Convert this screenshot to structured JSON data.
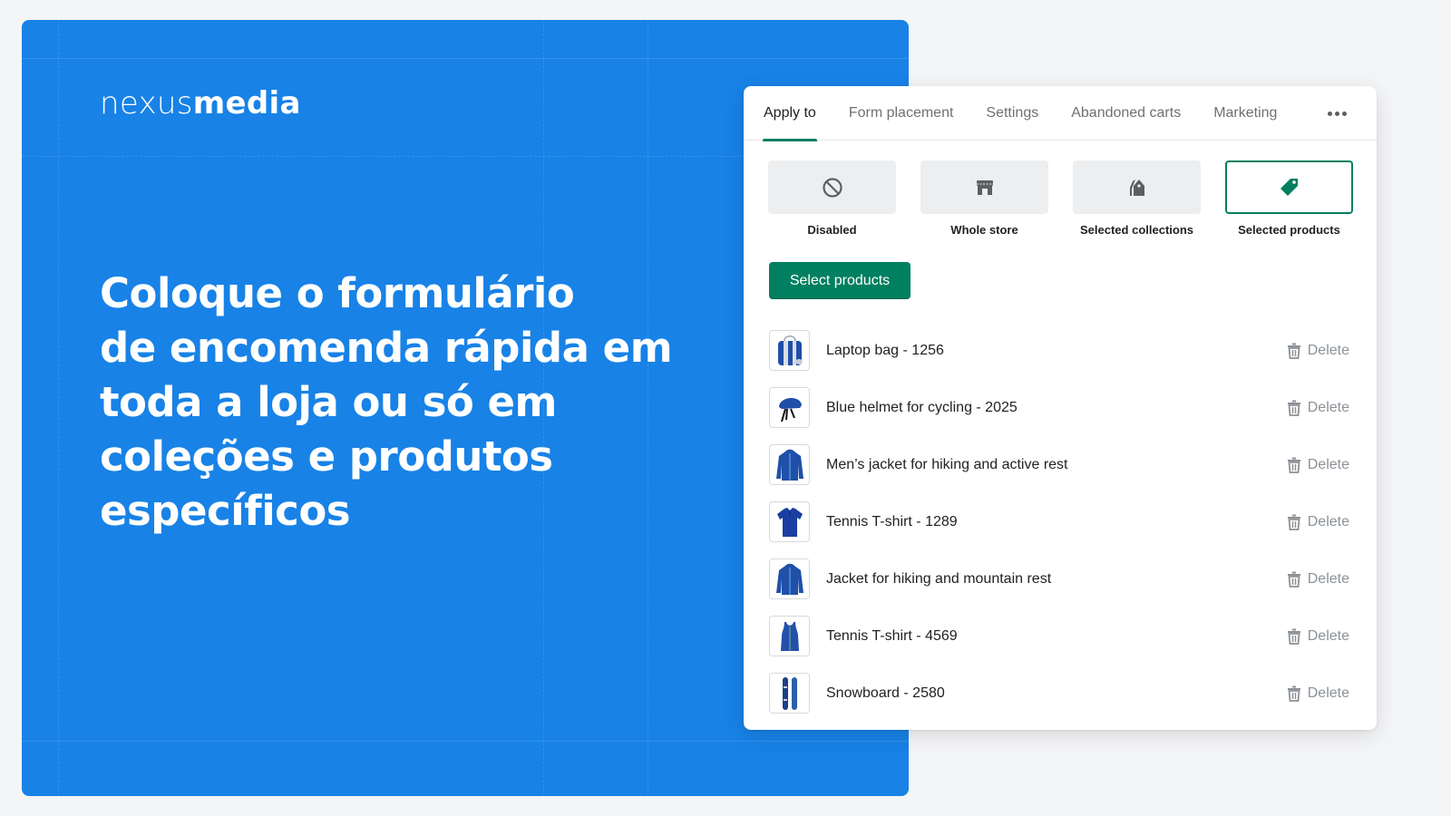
{
  "brand": {
    "logo_light": "nexus",
    "logo_bold": "media"
  },
  "headline": {
    "lines": [
      "Coloque o formulário",
      "de encomenda rápida em",
      "toda a loja ou só em",
      "coleções e produtos",
      "específicos"
    ]
  },
  "tabs": [
    {
      "label": "Apply to",
      "active": true
    },
    {
      "label": "Form placement",
      "active": false
    },
    {
      "label": "Settings",
      "active": false
    },
    {
      "label": "Abandoned carts",
      "active": false
    },
    {
      "label": "Marketing",
      "active": false
    }
  ],
  "more_icon": "horizontal-dots-icon",
  "apply_options": [
    {
      "label": "Disabled",
      "icon": "disabled-circle-icon",
      "selected": false
    },
    {
      "label": "Whole store",
      "icon": "store-icon",
      "selected": false
    },
    {
      "label": "Selected collections",
      "icon": "collections-tags-icon",
      "selected": false
    },
    {
      "label": "Selected products",
      "icon": "product-tag-icon",
      "selected": true
    }
  ],
  "select_products_button": "Select products",
  "products": [
    {
      "name": "Laptop bag - 1256",
      "thumb": "bag-icon",
      "delete_label": "Delete"
    },
    {
      "name": "Blue helmet for cycling - 2025",
      "thumb": "helmet-icon",
      "delete_label": "Delete"
    },
    {
      "name": "Men’s jacket for hiking and active rest",
      "thumb": "jacket-icon",
      "delete_label": "Delete"
    },
    {
      "name": "Tennis T-shirt - 1289",
      "thumb": "tshirt-icon",
      "delete_label": "Delete"
    },
    {
      "name": "Jacket for hiking and mountain rest",
      "thumb": "jacket-icon",
      "delete_label": "Delete"
    },
    {
      "name": "Tennis T-shirt - 4569",
      "thumb": "tank-top-icon",
      "delete_label": "Delete"
    },
    {
      "name": "Snowboard - 2580",
      "thumb": "snowboard-icon",
      "delete_label": "Delete"
    }
  ],
  "colors": {
    "hero_blue": "#1882e6",
    "accent_green": "#008060",
    "icon_gray": "#5c5f62"
  }
}
